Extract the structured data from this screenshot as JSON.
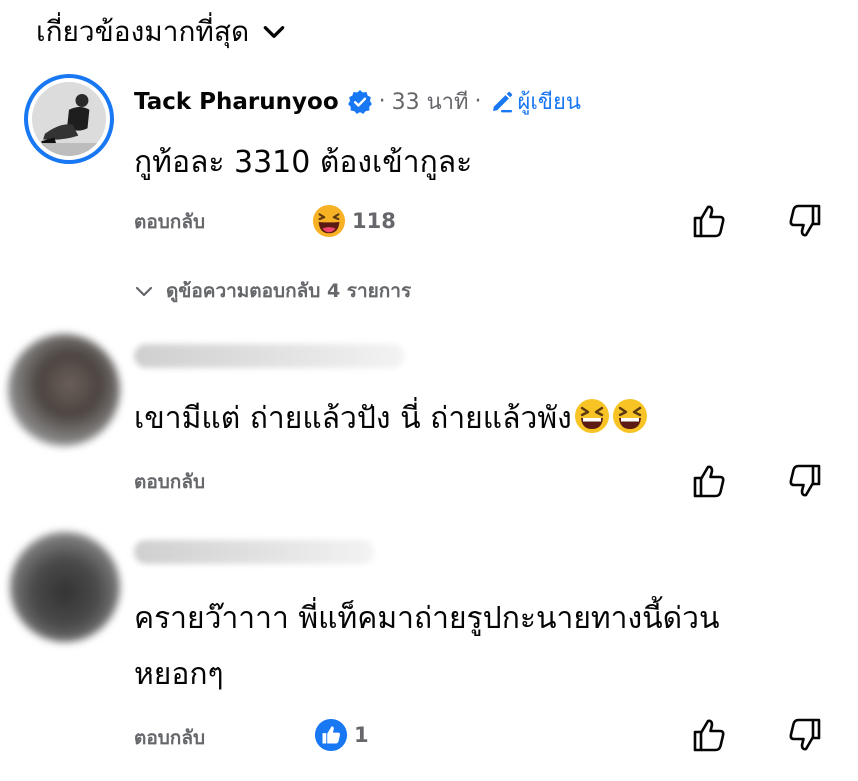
{
  "sort": {
    "label": "เกี่ยวข้องมากที่สุด"
  },
  "comments": [
    {
      "author": "Tack Pharunyoo",
      "time": "33 นาที",
      "author_badge": "ผู้เขียน",
      "text": "กูท้อละ 3310 ต้องเข้ากูละ",
      "reply_label": "ตอบกลับ",
      "reaction_icon": "laughing-emoji-icon",
      "reaction_count": "118",
      "view_replies_label": "ดูข้อความตอบกลับ 4 รายการ"
    },
    {
      "text": "เขามีแต่ ถ่ายแล้วปัง นี่ ถ่ายแล้วพัง",
      "trailing_emoji": "grinning-squinting-emoji-icon",
      "reply_label": "ตอบกลับ"
    },
    {
      "text_line1": "ครายว๊าาาา พี่แท็คมาถ่ายรูปกะนายทางนี้ด่วน",
      "text_line2": "หยอกๆ",
      "reply_label": "ตอบกลับ",
      "reaction_icon": "like-reaction-icon",
      "reaction_count": "1"
    }
  ],
  "colors": {
    "accent": "#1877f2",
    "secondary_text": "#65676b",
    "primary_text": "#050505"
  }
}
